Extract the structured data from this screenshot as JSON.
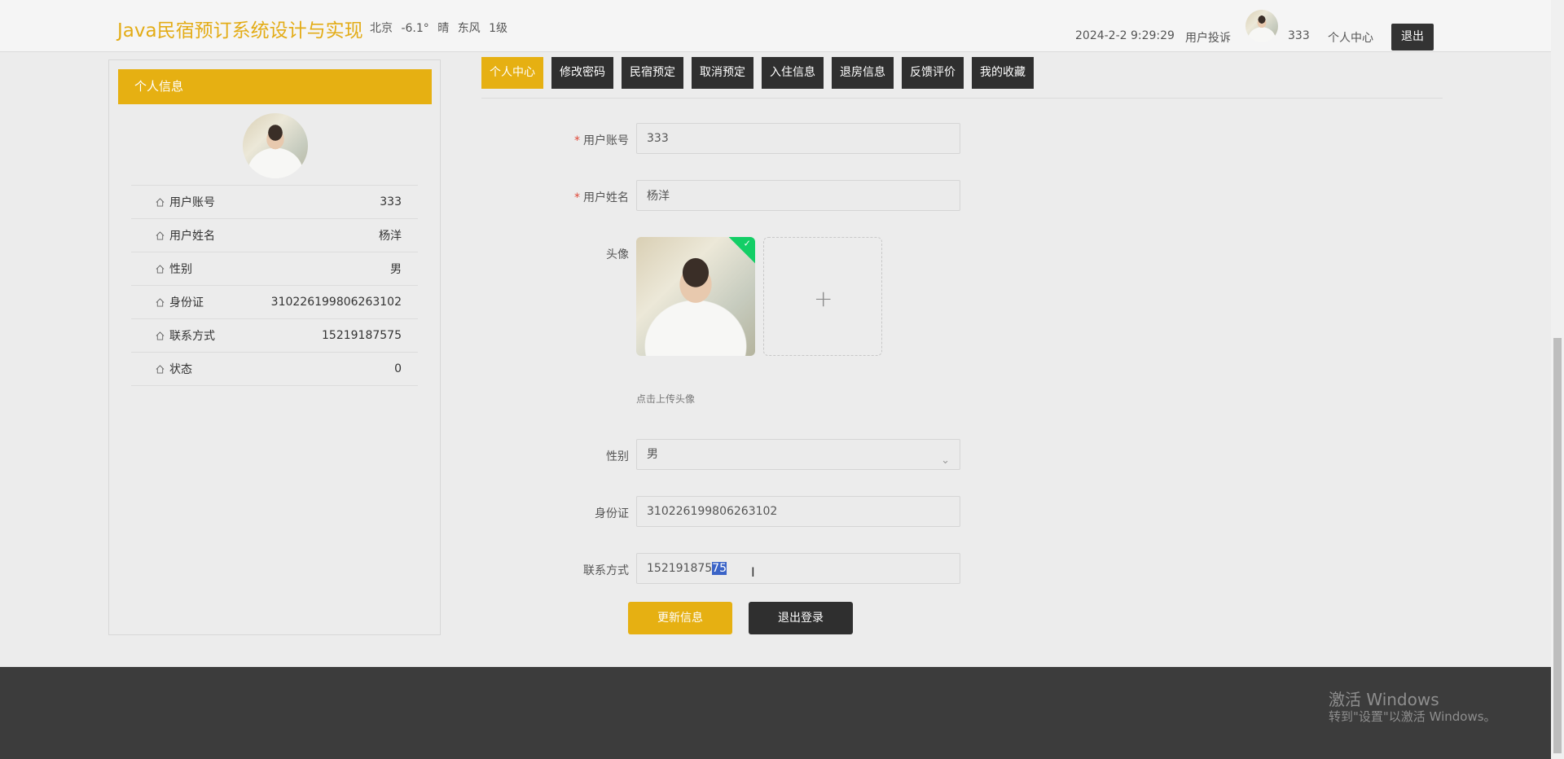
{
  "header": {
    "title": "Java民宿预订系统设计与实现",
    "weather": {
      "city": "北京",
      "temp": "-6.1°",
      "condition": "晴",
      "wind": "东风",
      "level": "1级"
    },
    "datetime": "2024-2-2 9:29:29",
    "complaint": "用户投诉",
    "username": "333",
    "profile_center": "个人中心",
    "logout": "退出"
  },
  "sidebar": {
    "header": "个人信息",
    "rows": [
      {
        "label": "用户账号",
        "value": "333"
      },
      {
        "label": "用户姓名",
        "value": "杨洋"
      },
      {
        "label": "性别",
        "value": "男"
      },
      {
        "label": "身份证",
        "value": "310226199806263102"
      },
      {
        "label": "联系方式",
        "value": "15219187575"
      },
      {
        "label": "状态",
        "value": "0"
      }
    ]
  },
  "tabs": [
    "个人中心",
    "修改密码",
    "民宿预定",
    "取消预定",
    "入住信息",
    "退房信息",
    "反馈评价",
    "我的收藏"
  ],
  "form": {
    "account": {
      "label": "用户账号",
      "value": "333"
    },
    "name": {
      "label": "用户姓名",
      "value": "杨洋"
    },
    "avatar": {
      "label": "头像",
      "hint": "点击上传头像",
      "add": "+"
    },
    "gender": {
      "label": "性别",
      "value": "男"
    },
    "idcard": {
      "label": "身份证",
      "value": "310226199806263102"
    },
    "phone": {
      "label": "联系方式",
      "value_unselected": "152191875",
      "value_selected": "75"
    },
    "update_button": "更新信息",
    "logout_button": "退出登录"
  },
  "watermark": {
    "line1": "激活 Windows",
    "line2": "转到\"设置\"以激活 Windows。"
  },
  "colors": {
    "accent": "#e6b012",
    "dark": "#2f2f2f",
    "footer": "#3c3c3c"
  }
}
